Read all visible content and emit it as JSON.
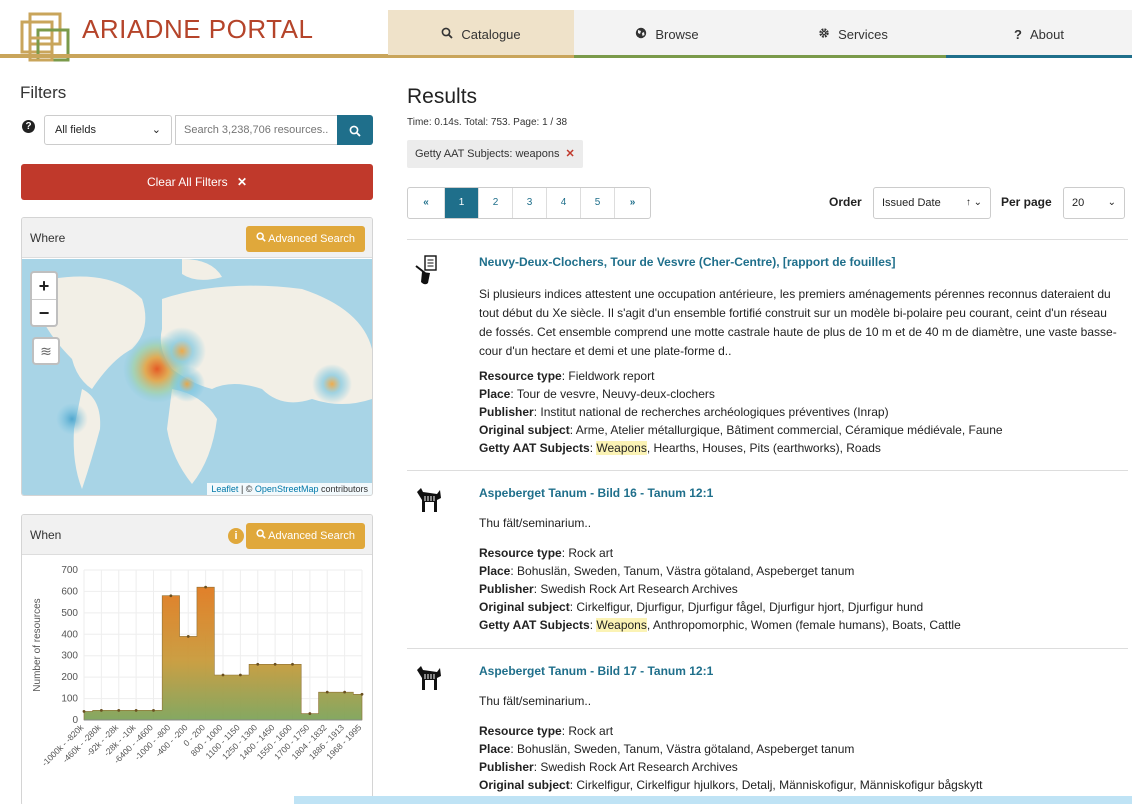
{
  "header": {
    "brand": "ARIADNE PORTAL",
    "nav": [
      {
        "label": "Catalogue",
        "icon": "search-icon",
        "underline": "#c9a55b"
      },
      {
        "label": "Browse",
        "icon": "globe-icon",
        "underline": "#7a9a4a"
      },
      {
        "label": "Services",
        "icon": "gear-icon",
        "underline": "#7a9a4a"
      },
      {
        "label": "About",
        "icon": "question-icon",
        "underline": "#1f6f8b"
      }
    ]
  },
  "filters": {
    "title": "Filters",
    "field_select": "All fields",
    "search_placeholder": "Search 3,238,706 resources...",
    "clear_label": "Clear All Filters"
  },
  "where": {
    "title": "Where",
    "advanced_label": "Advanced Search",
    "zoom_in": "+",
    "zoom_out": "−",
    "attrib_leaflet": "Leaflet",
    "attrib_sep": " | © ",
    "attrib_osm": "OpenStreetMap",
    "attrib_tail": " contributors"
  },
  "when": {
    "title": "When",
    "advanced_label": "Advanced Search"
  },
  "chart_data": {
    "type": "area",
    "ylabel": "Number of resources",
    "xlabel": "",
    "ylim": [
      0,
      700
    ],
    "yticks": [
      0,
      100,
      200,
      300,
      400,
      500,
      600,
      700
    ],
    "x": [
      "-1000k - -820k",
      "-460k - -280k",
      "-92k - -28k",
      "-28k - -10k",
      "-6400 - -4600",
      "-1000 - -800",
      "-400 - -200",
      "0 - 200",
      "800 - 1000",
      "1100 - 1150",
      "1250 - 1300",
      "1400 - 1450",
      "1550 - 1600",
      "1700 - 1750",
      "1804 - 1832",
      "1886 - 1913",
      "1968 - 1995"
    ],
    "values": [
      40,
      45,
      45,
      45,
      45,
      580,
      390,
      620,
      210,
      210,
      260,
      260,
      260,
      30,
      130,
      130,
      120
    ]
  },
  "results": {
    "title": "Results",
    "meta": "Time: 0.14s. Total: 753. Page: 1 / 38",
    "chip": "Getty AAT Subjects: weapons",
    "pager": [
      "«",
      "1",
      "2",
      "3",
      "4",
      "5",
      "»"
    ],
    "order_label": "Order",
    "order_value": "Issued Date",
    "perpage_label": "Per page",
    "perpage_value": "20",
    "items": [
      {
        "title": "Neuvy-Deux-Clochers, Tour de Vesvre (Cher-Centre), [rapport de fouilles]",
        "desc": "Si plusieurs indices attestent une occupation antérieure, les premiers aménagements pérennes reconnus dateraient du tout début du Xe siècle. Il s'agit d'un ensemble fortifié construit sur un modèle bi-polaire peu courant, ceint d'un réseau de fossés. Cet ensemble comprend une motte castrale haute de plus de 10 m et de 40 m de diamètre, une vaste basse-cour d'un hectare et demi et une plate-forme d..",
        "resource_type": "Fieldwork report",
        "place": "Tour de vesvre, Neuvy-deux-clochers",
        "publisher": "Institut national de recherches archéologiques préventives (Inrap)",
        "original_subject": "Arme, Atelier métallurgique, Bâtiment commercial, Céramique médiévale, Faune",
        "aat_highlight": "Weapons",
        "aat_rest": ", Hearths, Houses, Pits (earthworks), Roads"
      },
      {
        "title": "Aspeberget Tanum - Bild 16 - Tanum 12:1",
        "desc": "Thu fält/seminarium..",
        "resource_type": "Rock art",
        "place": "Bohuslän, Sweden, Tanum, Västra götaland, Aspeberget tanum",
        "publisher": "Swedish Rock Art Research Archives",
        "original_subject": "Cirkelfigur, Djurfigur, Djurfigur fågel, Djurfigur hjort, Djurfigur hund",
        "aat_highlight": "Weapons",
        "aat_rest": ", Anthropomorphic, Women (female humans), Boats, Cattle"
      },
      {
        "title": "Aspeberget Tanum - Bild 17 - Tanum 12:1",
        "desc": "Thu fält/seminarium..",
        "resource_type": "Rock art",
        "place": "Bohuslän, Sweden, Tanum, Västra götaland, Aspeberget tanum",
        "publisher": "Swedish Rock Art Research Archives",
        "original_subject": "Cirkelfigur, Cirkelfigur hjulkors, Detalj, Människofigur, Människofigur bågskytt"
      }
    ],
    "labels": {
      "resource_type": "Resource type",
      "place": "Place",
      "publisher": "Publisher",
      "original_subject": "Original subject",
      "aat": "Getty AAT Subjects"
    }
  }
}
